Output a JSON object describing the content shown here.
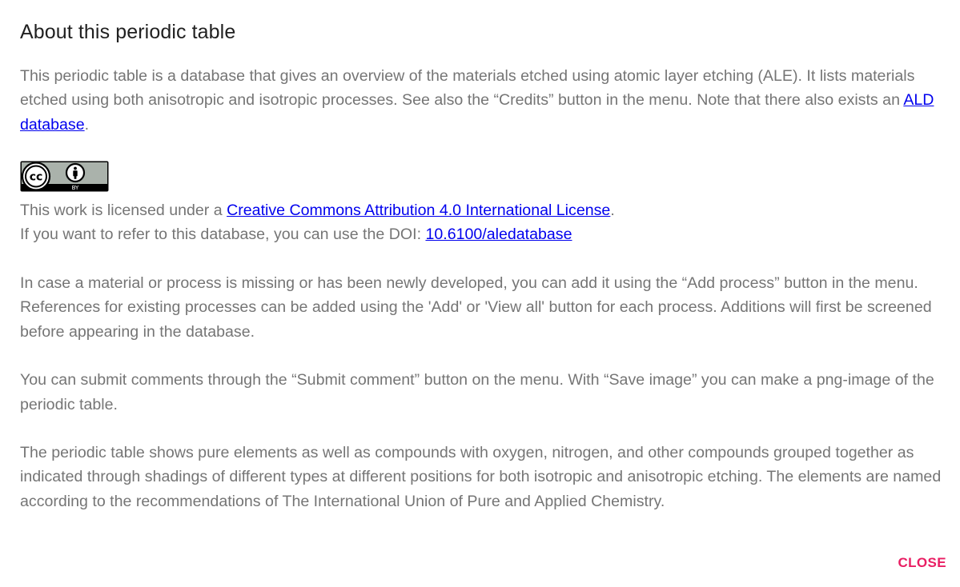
{
  "dialog": {
    "title": "About this periodic table",
    "intro": {
      "text_before_link": "This periodic table is a database that gives an overview of the materials etched using atomic layer etching (ALE). It lists materials etched using both anisotropic and isotropic processes. See also the “Credits” button in the menu. Note that there also exists an ",
      "link_label": "ALD database",
      "text_after_link": "."
    },
    "license": {
      "badge": {
        "icon": "creative-commons-by-badge",
        "cc_text": "cc",
        "by_text": "BY"
      },
      "text_before_link": "This work is licensed under a ",
      "link_label": "Creative Commons Attribution 4.0 International License",
      "text_after_link": ".",
      "doi_text": "If you want to refer to this database, you can use the DOI: ",
      "doi_link_label": "10.6100/aledatabase"
    },
    "paragraphs": [
      "In case a material or process is missing or has been newly developed, you can add it using the “Add process” button in the menu. References for existing processes can be added using the 'Add' or 'View all' button for each process. Additions will first be screened before appearing in the database.",
      "You can submit comments through the “Submit comment” button on the menu. With “Save image” you can make a png-image of the periodic table.",
      "The periodic table shows pure elements as well as compounds with oxygen, nitrogen, and other compounds grouped together as indicated through shadings of different types at different positions for both isotropic and anisotropic etching. The elements are named according to the recommendations of The International Union of Pure and Applied Chemistry."
    ],
    "close_label": "CLOSE",
    "colors": {
      "title": "#212121",
      "body_text": "#757575",
      "link": "#0000ee",
      "close": "#e91e63",
      "badge_bg": "#aab2ab",
      "badge_border": "#000000"
    }
  }
}
